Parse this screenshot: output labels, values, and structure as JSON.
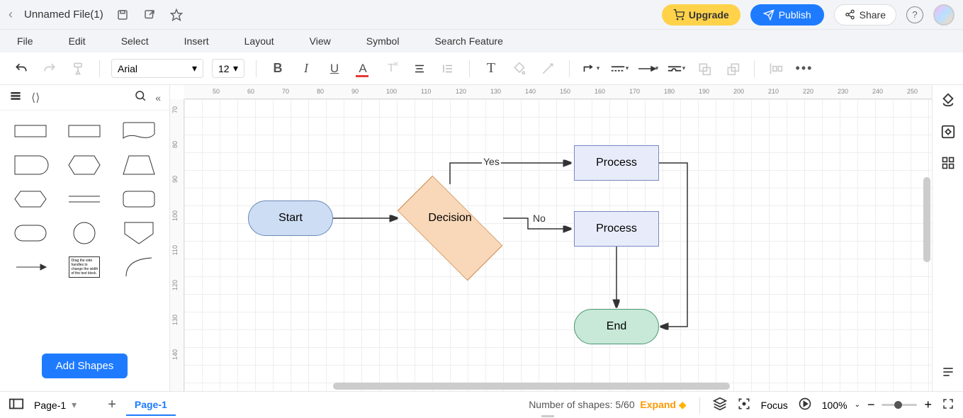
{
  "topbar": {
    "file_title": "Unnamed File(1)",
    "upgrade_label": "Upgrade",
    "publish_label": "Publish",
    "share_label": "Share"
  },
  "menu": {
    "file": "File",
    "edit": "Edit",
    "select": "Select",
    "insert": "Insert",
    "layout": "Layout",
    "view": "View",
    "symbol": "Symbol",
    "search": "Search Feature"
  },
  "toolbar": {
    "font": "Arial",
    "size": "12"
  },
  "shapes_panel": {
    "add_btn": "Add Shapes"
  },
  "canvas": {
    "ruler_h": [
      "50",
      "60",
      "70",
      "80",
      "90",
      "100",
      "110",
      "120",
      "130",
      "140",
      "150",
      "160",
      "170",
      "180",
      "190",
      "200",
      "210",
      "220",
      "230",
      "240",
      "250"
    ],
    "ruler_v": [
      "70",
      "80",
      "90",
      "100",
      "110",
      "120",
      "130",
      "140"
    ],
    "nodes": {
      "start": "Start",
      "decision": "Decision",
      "process1": "Process",
      "process2": "Process",
      "end": "End"
    },
    "edge_labels": {
      "yes": "Yes",
      "no": "No"
    }
  },
  "bottom": {
    "page_name": "Page-1",
    "active_tab": "Page-1",
    "shape_count_label": "Number of shapes: 5/60",
    "expand": "Expand",
    "focus": "Focus",
    "zoom": "100%"
  },
  "chart_data": {
    "type": "flowchart",
    "nodes": [
      {
        "id": "start",
        "label": "Start",
        "shape": "terminator"
      },
      {
        "id": "decision",
        "label": "Decision",
        "shape": "decision"
      },
      {
        "id": "process1",
        "label": "Process",
        "shape": "process"
      },
      {
        "id": "process2",
        "label": "Process",
        "shape": "process"
      },
      {
        "id": "end",
        "label": "End",
        "shape": "terminator"
      }
    ],
    "edges": [
      {
        "from": "start",
        "to": "decision",
        "label": ""
      },
      {
        "from": "decision",
        "to": "process1",
        "label": "Yes"
      },
      {
        "from": "decision",
        "to": "process2",
        "label": "No"
      },
      {
        "from": "process2",
        "to": "end",
        "label": ""
      },
      {
        "from": "process1",
        "to": "end",
        "label": ""
      }
    ]
  }
}
